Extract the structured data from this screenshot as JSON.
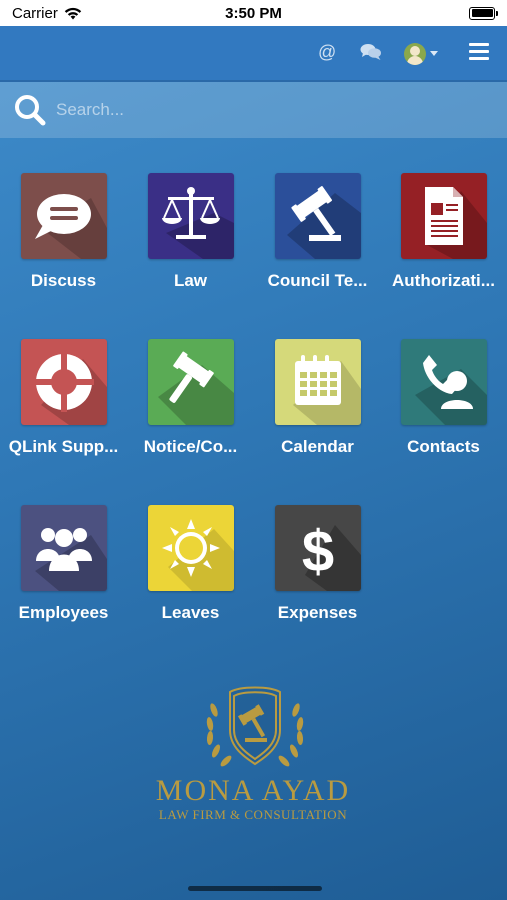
{
  "status_bar": {
    "carrier": "Carrier",
    "time": "3:50 PM"
  },
  "nav": {
    "icons": [
      "at-icon",
      "chat-icon",
      "avatar",
      "caret-down-icon",
      "hamburger-menu-icon"
    ]
  },
  "search": {
    "placeholder": "Search...",
    "value": ""
  },
  "apps": [
    {
      "label": "Discuss",
      "icon": "chat-bubble-icon",
      "color": "#7d4e4b"
    },
    {
      "label": "Law",
      "icon": "scales-icon",
      "color": "#3a2f86"
    },
    {
      "label": "Council Te...",
      "icon": "gavel-icon",
      "color": "#2b4f9a"
    },
    {
      "label": "Authorizati...",
      "icon": "document-icon",
      "color": "#952025"
    },
    {
      "label": "QLink Supp...",
      "icon": "lifebuoy-icon",
      "color": "#c45454"
    },
    {
      "label": "Notice/Co...",
      "icon": "gavel-icon",
      "color": "#5aab55"
    },
    {
      "label": "Calendar",
      "icon": "calendar-icon",
      "color": "#d5d97a"
    },
    {
      "label": "Contacts",
      "icon": "contact-phone-icon",
      "color": "#2f7a7a"
    },
    {
      "label": "Employees",
      "icon": "people-group-icon",
      "color": "#4c5180"
    },
    {
      "label": "Leaves",
      "icon": "sun-icon",
      "color": "#ecd537"
    },
    {
      "label": "Expenses",
      "icon": "dollar-icon",
      "color": "#474747"
    }
  ],
  "logo": {
    "title": "MONA AYAD",
    "subtitle": "LAW FIRM & CONSULTATION",
    "color": "#b99b41"
  }
}
